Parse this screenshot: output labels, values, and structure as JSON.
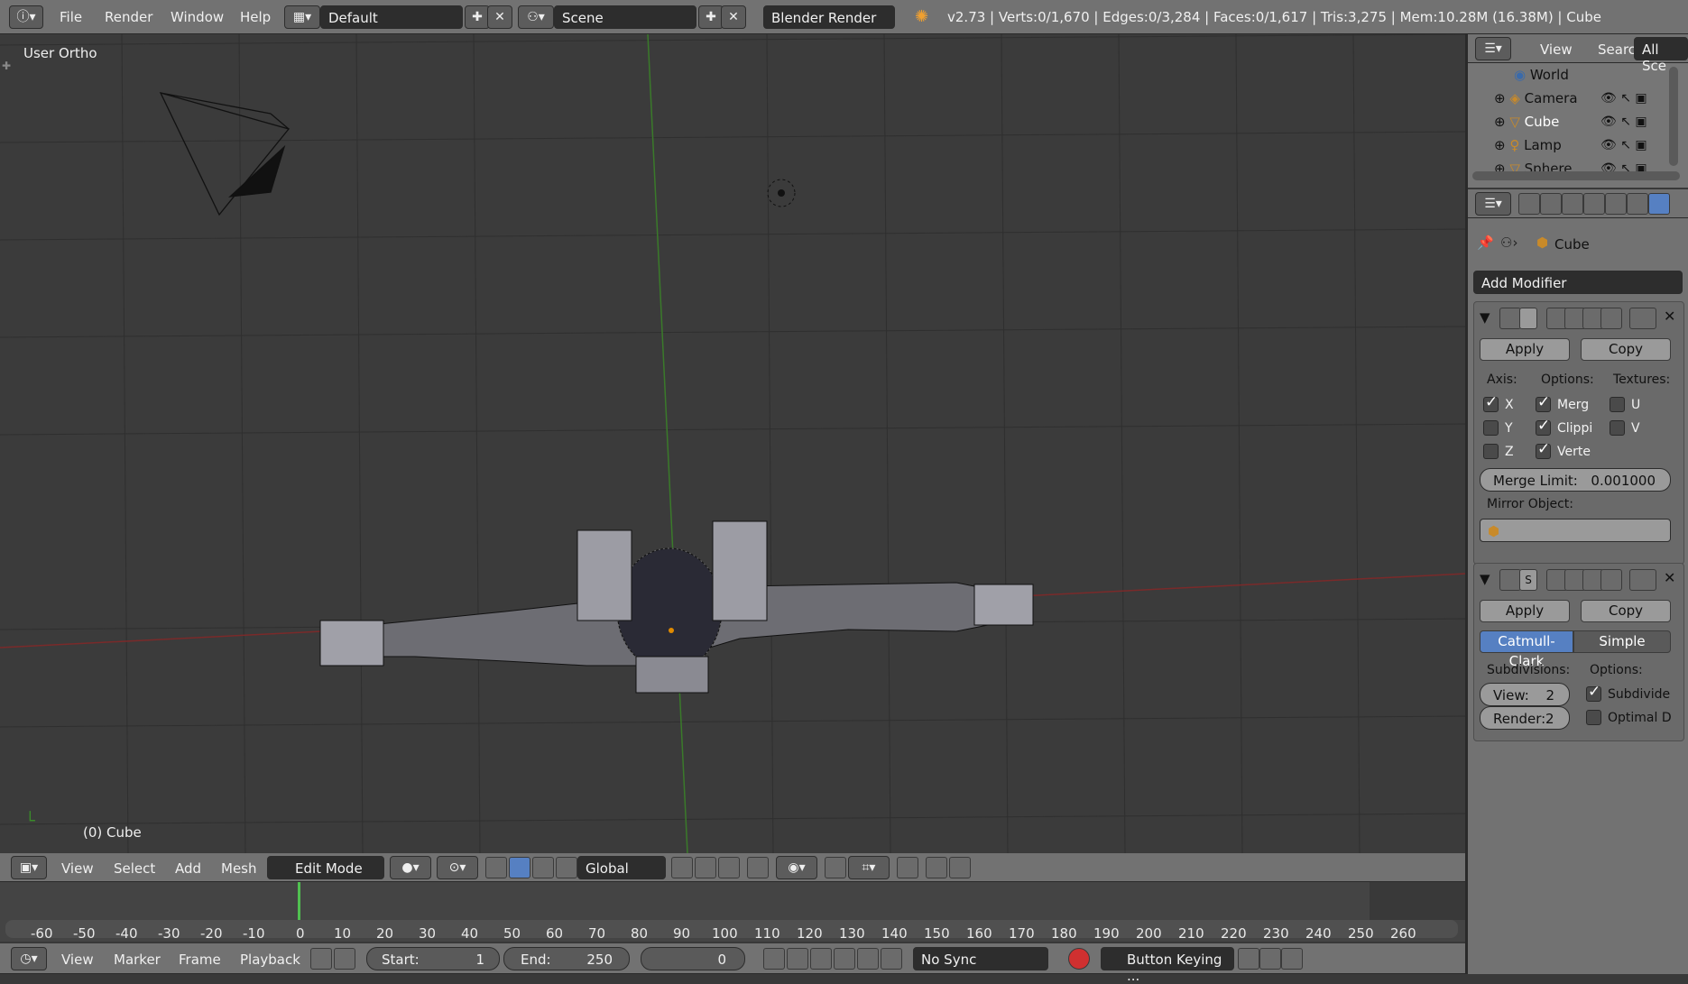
{
  "top_bar": {
    "info_icon": "info-icon",
    "menus": [
      "File",
      "Render",
      "Window",
      "Help"
    ],
    "layout": "Default",
    "scene": "Scene",
    "render_engine": "Blender Render",
    "stats": "v2.73 | Verts:0/1,670 | Edges:0/3,284 | Faces:0/1,617 | Tris:3,275 | Mem:10.28M (16.38M) | Cube"
  },
  "viewport": {
    "view_label": "User Ortho",
    "object_label": "(0) Cube"
  },
  "view_header": {
    "menus": [
      "View",
      "Select",
      "Add",
      "Mesh"
    ],
    "mode": "Edit Mode",
    "orientation": "Global"
  },
  "timeline": {
    "ticks": [
      "-60",
      "-50",
      "-40",
      "-30",
      "-20",
      "-10",
      "0",
      "10",
      "20",
      "30",
      "40",
      "50",
      "60",
      "70",
      "80",
      "90",
      "100",
      "110",
      "120",
      "130",
      "140",
      "150",
      "160",
      "170",
      "180",
      "190",
      "200",
      "210",
      "220",
      "230",
      "240",
      "250",
      "260"
    ],
    "current_frame_marker": 0
  },
  "bottom_bar": {
    "menus": [
      "View",
      "Marker",
      "Frame",
      "Playback"
    ],
    "start_label": "Start:",
    "start_value": "1",
    "end_label": "End:",
    "end_value": "250",
    "current_frame": "0",
    "sync": "No Sync",
    "keying": "Button Keying ..."
  },
  "outliner": {
    "menus": [
      "View",
      "Search"
    ],
    "filter": "All Sce",
    "items": [
      {
        "name": "World",
        "icon": "world-icon"
      },
      {
        "name": "Camera",
        "icon": "camera-icon"
      },
      {
        "name": "Cube",
        "icon": "mesh-icon"
      },
      {
        "name": "Lamp",
        "icon": "lamp-icon"
      },
      {
        "name": "Sphere",
        "icon": "mesh-icon"
      }
    ]
  },
  "properties": {
    "object_name": "Cube",
    "add_modifier": "Add Modifier",
    "mirror": {
      "apply": "Apply",
      "copy": "Copy",
      "axis_label": "Axis:",
      "options_label": "Options:",
      "textures_label": "Textures:",
      "axes": [
        {
          "label": "X",
          "checked": true
        },
        {
          "label": "Y",
          "checked": false
        },
        {
          "label": "Z",
          "checked": false
        }
      ],
      "options": [
        {
          "label": "Merg",
          "checked": true
        },
        {
          "label": "Clippi",
          "checked": true
        },
        {
          "label": "Verte",
          "checked": true
        }
      ],
      "textures": [
        {
          "label": "U",
          "checked": false
        },
        {
          "label": "V",
          "checked": false
        }
      ],
      "merge_limit_label": "Merge Limit:",
      "merge_limit_value": "0.001000",
      "mirror_object_label": "Mirror Object:"
    },
    "subsurf": {
      "name_field": "S",
      "apply": "Apply",
      "copy": "Copy",
      "type_catmull": "Catmull-Clark",
      "type_simple": "Simple",
      "subdivisions_label": "Subdivisions:",
      "options_label": "Options:",
      "view_label": "View:",
      "view_value": "2",
      "render_label": "Render:",
      "render_value": "2",
      "subdivide_uvs": {
        "label": "Subdivide",
        "checked": true
      },
      "optimal_display": {
        "label": "Optimal D",
        "checked": false
      }
    }
  },
  "colors": {
    "accent": "#5680c2",
    "panel": "#727272",
    "viewport": "#3b3b3b",
    "x_axis": "#8a2a2a",
    "y_axis": "#3a8a2a"
  }
}
